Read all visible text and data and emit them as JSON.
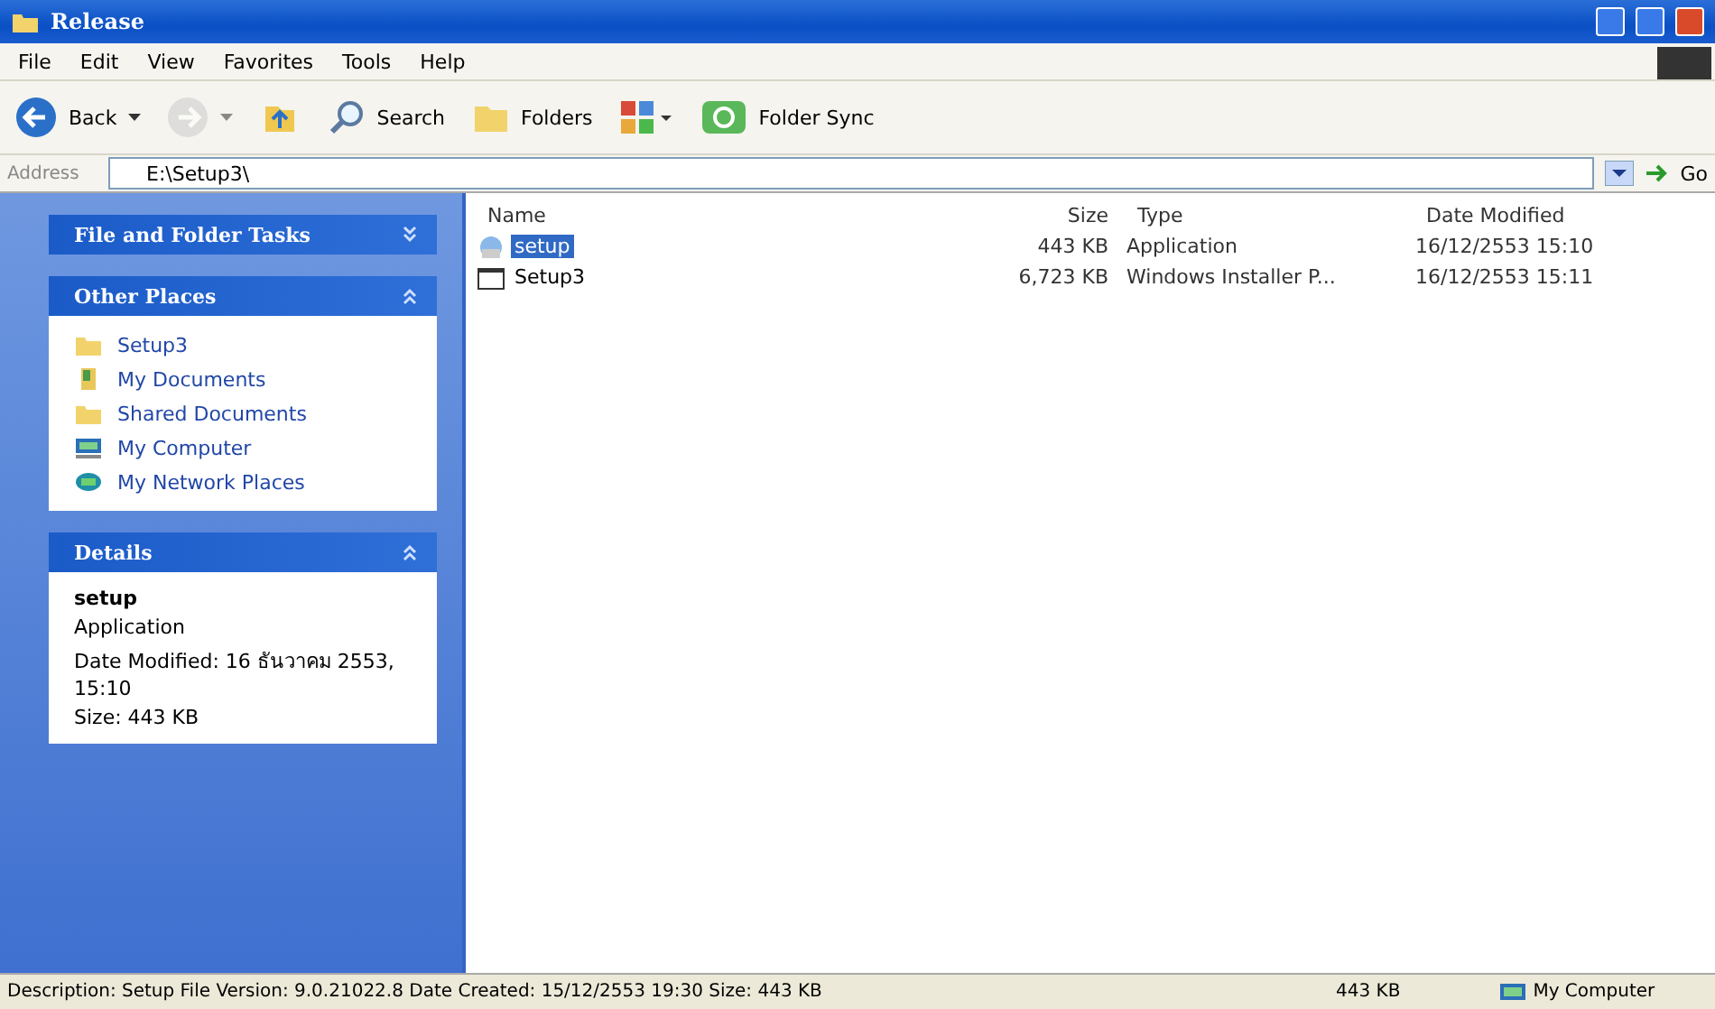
{
  "window": {
    "title": "Release"
  },
  "menu": [
    "File",
    "Edit",
    "View",
    "Favorites",
    "Tools",
    "Help"
  ],
  "toolbar": [
    {
      "kind": "back",
      "label": "Back",
      "disabled": false
    },
    {
      "kind": "forward",
      "disabled": true
    },
    {
      "kind": "up",
      "disabled": false
    },
    {
      "kind": "search",
      "label": "Search",
      "disabled": false
    },
    {
      "kind": "folders",
      "label": "Folders",
      "disabled": false
    },
    {
      "kind": "views",
      "disabled": false
    },
    {
      "kind": "sync",
      "label": "Folder Sync",
      "disabled": false
    }
  ],
  "address": {
    "label": "Address",
    "value": "E:\\Setup3\\",
    "go": "Go"
  },
  "sidebar": [
    {
      "title": "File and Folder Tasks",
      "expanded": false
    },
    {
      "title": "Other Places",
      "expanded": true,
      "items": [
        {
          "kind": "folder",
          "label": "Setup3"
        },
        {
          "kind": "documents",
          "label": "My Documents"
        },
        {
          "kind": "folder",
          "label": "Shared Documents"
        },
        {
          "kind": "computer",
          "label": "My Computer"
        },
        {
          "kind": "network",
          "label": "My Network Places"
        }
      ]
    },
    {
      "title": "Details",
      "expanded": true,
      "details": {
        "name": "setup",
        "type": "Application",
        "modified": "Date Modified: 16 ธันวาคม 2553, 15:10",
        "size": "Size: 443 KB"
      }
    }
  ],
  "table": {
    "columns": [
      "Name",
      "Size",
      "Type",
      "Date Modified"
    ],
    "rows": [
      {
        "kind": "app",
        "name": "setup",
        "size": "443 KB",
        "type": "Application",
        "modified": "16/12/2553 15:10",
        "selected": true
      },
      {
        "kind": "installer",
        "name": "Setup3",
        "size": "6,723 KB",
        "type": "Windows Installer P...",
        "modified": "16/12/2553 15:11",
        "selected": false
      }
    ]
  },
  "status_bar": {
    "description": "Description: Setup File Version: 9.0.21022.8 Date Created: 15/12/2553 19:30 Size: 443 KB",
    "size": "443 KB",
    "zone": "My Computer"
  }
}
